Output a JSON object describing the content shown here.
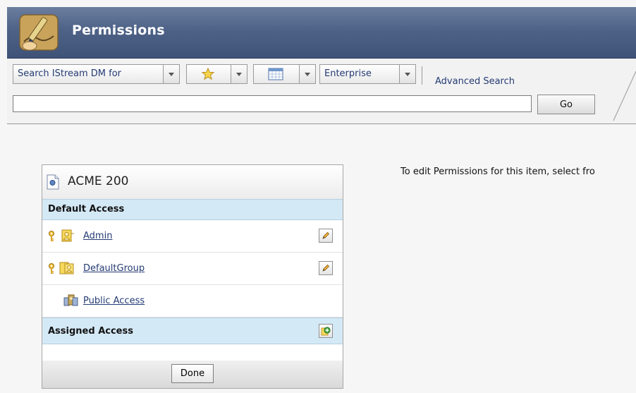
{
  "header": {
    "title": "Permissions",
    "icon": "pen-writing-icon",
    "bar_color": "#4e6287"
  },
  "search": {
    "scope_label": "Search IStream DM for",
    "favorites_icon": "star-icon",
    "calendar_icon": "calendar-icon",
    "source_label": "Enterprise",
    "advanced_link": "Advanced Search",
    "query_value": "",
    "go_label": "Go"
  },
  "instructions": "To edit Permissions for this item, select fro",
  "panel": {
    "title": "ACME 200",
    "title_icon": "document-icon",
    "default_access": {
      "label": "Default Access",
      "rows": [
        {
          "name": "Admin",
          "icon": "user-icon",
          "has_key": true,
          "editable": true
        },
        {
          "name": "DefaultGroup",
          "icon": "group-icon",
          "has_key": true,
          "editable": true
        },
        {
          "name": "Public Access",
          "icon": "public-access-icon",
          "has_key": false,
          "editable": false
        }
      ]
    },
    "assigned_access": {
      "label": "Assigned Access",
      "add_icon": "add-icon"
    },
    "done_label": "Done"
  }
}
